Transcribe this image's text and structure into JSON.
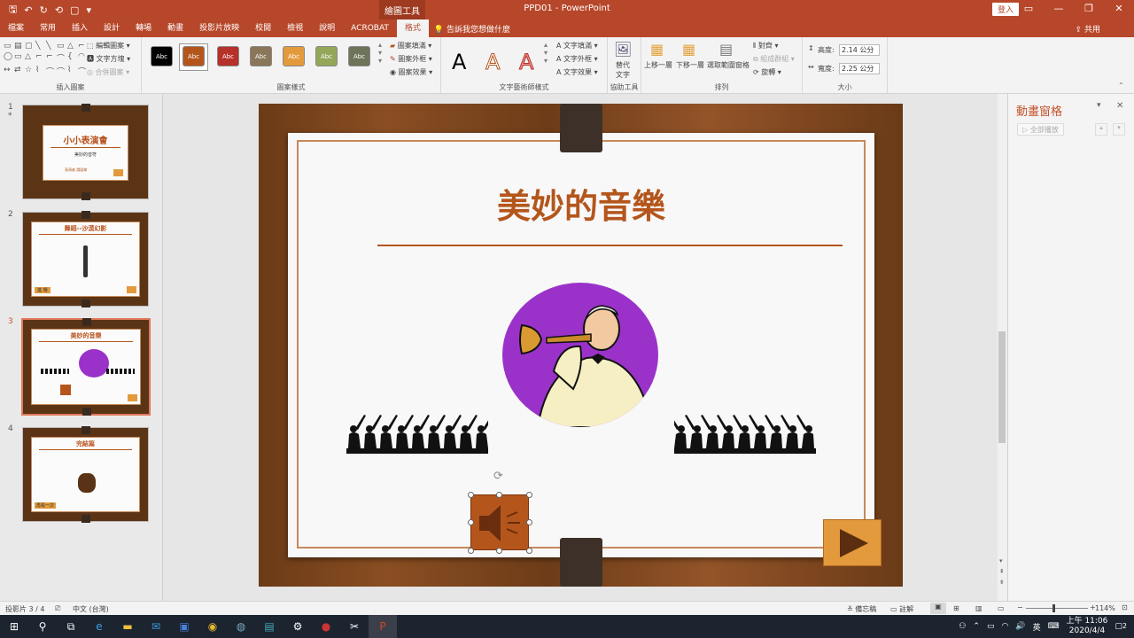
{
  "titlebar": {
    "app_title": "PPD01 - PowerPoint",
    "context_tools": "繪圖工具",
    "login": "登入",
    "qat_icons": [
      "save-icon",
      "undo-icon",
      "redo-icon",
      "repeat-icon",
      "new-icon",
      "customize-icon"
    ]
  },
  "tabs": [
    "檔案",
    "常用",
    "插入",
    "設計",
    "轉場",
    "動畫",
    "投影片放映",
    "校閱",
    "檢視",
    "說明",
    "ACROBAT",
    "格式"
  ],
  "active_tab": "格式",
  "tellme": "告訴我您想做什麼",
  "share": "共用",
  "ribbon": {
    "insert_shapes": {
      "label": "插入圖案",
      "edit_shape": "編輯圖案",
      "text_box": "文字方塊",
      "merge_shapes": "合併圖案"
    },
    "shape_styles": {
      "label": "圖案樣式",
      "fill": "圖案填滿",
      "outline": "圖案外框",
      "effects": "圖案效果",
      "sample": "Abc"
    },
    "wordart": {
      "label": "文字藝術師樣式",
      "text_fill": "文字填滿",
      "text_outline": "文字外框",
      "text_effects": "文字效果",
      "glyph": "A"
    },
    "accessibility": {
      "label": "協助工具",
      "alt_text_1": "替代",
      "alt_text_2": "文字"
    },
    "arrange": {
      "label": "排列",
      "bring_forward": "上移一層",
      "send_backward": "下移一層",
      "selection_pane": "選取範圍窗格",
      "align": "對齊",
      "group": "組成群組",
      "rotate": "旋轉"
    },
    "size": {
      "label": "大小",
      "height_label": "高度:",
      "height": "2.14 公分",
      "width_label": "寬度:",
      "width": "2.25 公分"
    }
  },
  "style_colors": [
    "#000000",
    "#b4561c",
    "#b5312a",
    "#8a7658",
    "#e39a3d",
    "#93a75a",
    "#6e7459"
  ],
  "thumbnails": [
    {
      "num": "1",
      "star": "*",
      "title": "小小表演會",
      "subtitle": "美妙的音符",
      "footer": "表演者 請鼓掌"
    },
    {
      "num": "2",
      "title": "舞蹈--沙漠幻影",
      "button": "進 場"
    },
    {
      "num": "3",
      "title": "美妙的音樂"
    },
    {
      "num": "4",
      "title": "完結篇",
      "button": "再看一次"
    }
  ],
  "slide": {
    "title": "美妙的音樂"
  },
  "animation_pane": {
    "title": "動畫窗格",
    "play_all": "全部播放"
  },
  "status": {
    "slide_info": "投影片 3 / 4",
    "language": "中文 (台灣)",
    "notes": "備忘稿",
    "comments": "註解",
    "zoom": "114%"
  },
  "taskbar": {
    "time": "上午 11:06",
    "date": "2020/4/4",
    "ime": "英",
    "notifications": "2"
  },
  "accent": "#b7472a"
}
